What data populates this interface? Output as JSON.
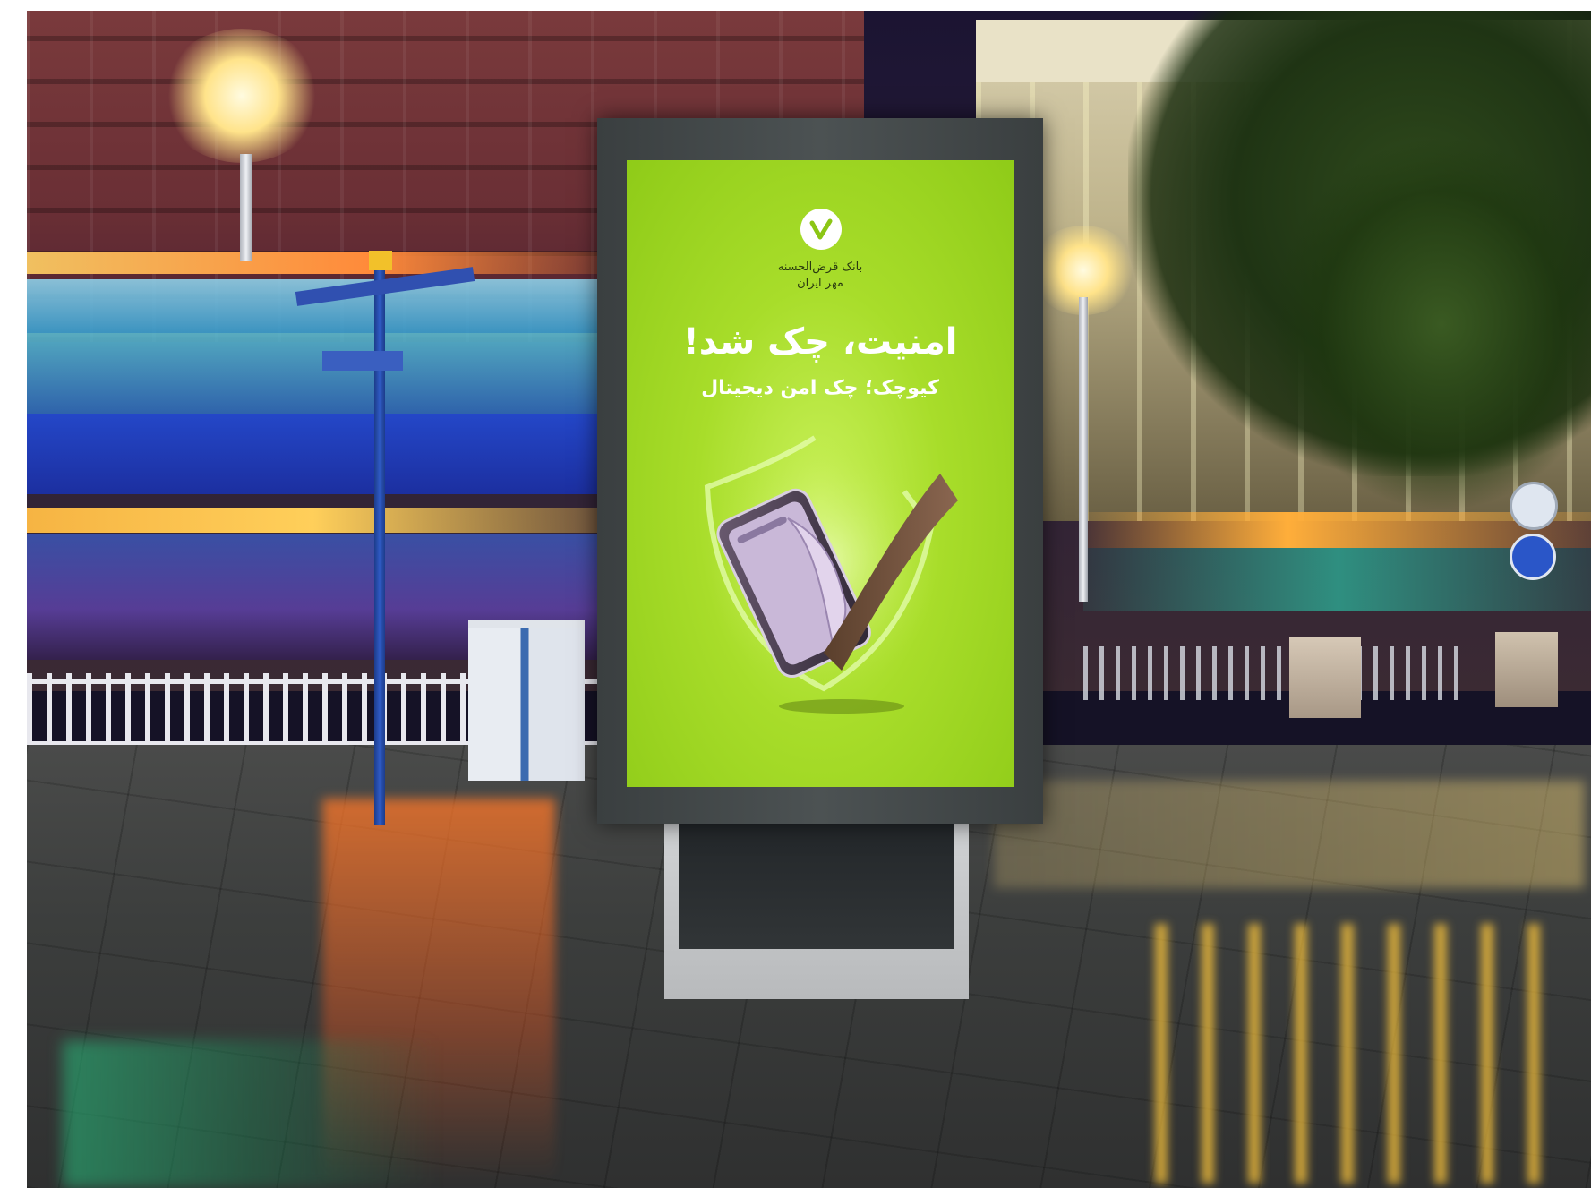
{
  "scene": {
    "setting": "rainy city street at night",
    "colors": {
      "poster_green": "#a8dd2a",
      "frame": "#454a4b",
      "text": "#ffffff"
    }
  },
  "billboard": {
    "bank_name_line1": "بانک قرض‌الحسنه",
    "bank_name_line2": "مهر ایران",
    "headline": "امنیت، چک شد!",
    "subline": "کیوچک؛ چک امن دیجیتال",
    "icons": [
      "checkmark-icon",
      "shield-icon",
      "smartphone-icon",
      "cheque-icon"
    ]
  }
}
